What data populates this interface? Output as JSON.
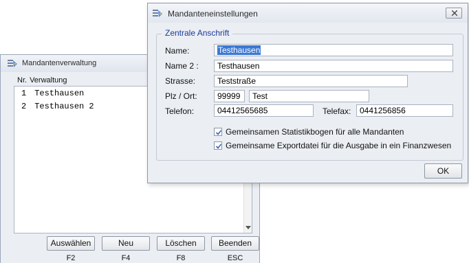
{
  "back_window": {
    "title": "Mandantenverwaltung",
    "icon": "app-icon",
    "list_header": {
      "nr": "Nr.",
      "verwaltung": "Verwaltung"
    },
    "rows": [
      {
        "nr": "1",
        "name": "Testhausen"
      },
      {
        "nr": "2",
        "name": "Testhausen 2"
      }
    ],
    "buttons": [
      {
        "label": "Auswählen",
        "key": "F2"
      },
      {
        "label": "Neu",
        "key": "F4"
      },
      {
        "label": "Löschen",
        "key": "F8"
      },
      {
        "label": "Beenden",
        "key": "ESC"
      }
    ]
  },
  "dialog": {
    "title": "Mandanteneinstellungen",
    "icon": "app-icon",
    "group_title": "Zentrale Anschrift",
    "name_label": "Name:",
    "name_value": "Testhausen",
    "name2_label": "Name 2 :",
    "name2_value": "Testhausen",
    "strasse_label": "Strasse:",
    "strasse_value": "Teststraße",
    "plz_ort_label": "Plz / Ort:",
    "plz_value": "99999",
    "ort_value": "Test",
    "telefon_label": "Telefon:",
    "telefon_value": "04412565685",
    "telefax_label": "Telefax:",
    "telefax_value": "0441256856",
    "checkbox1_label": "Gemeinsamen Statistikbogen für alle Mandanten",
    "checkbox1_checked": true,
    "checkbox2_label": "Gemeinsame Exportdatei für die Ausgabe in ein Finanzwesen",
    "checkbox2_checked": true,
    "ok_label": "OK"
  },
  "colors": {
    "group_title": "#1a3a9a",
    "selection": "#3a78d4",
    "window_bg": "#ebeef3"
  }
}
